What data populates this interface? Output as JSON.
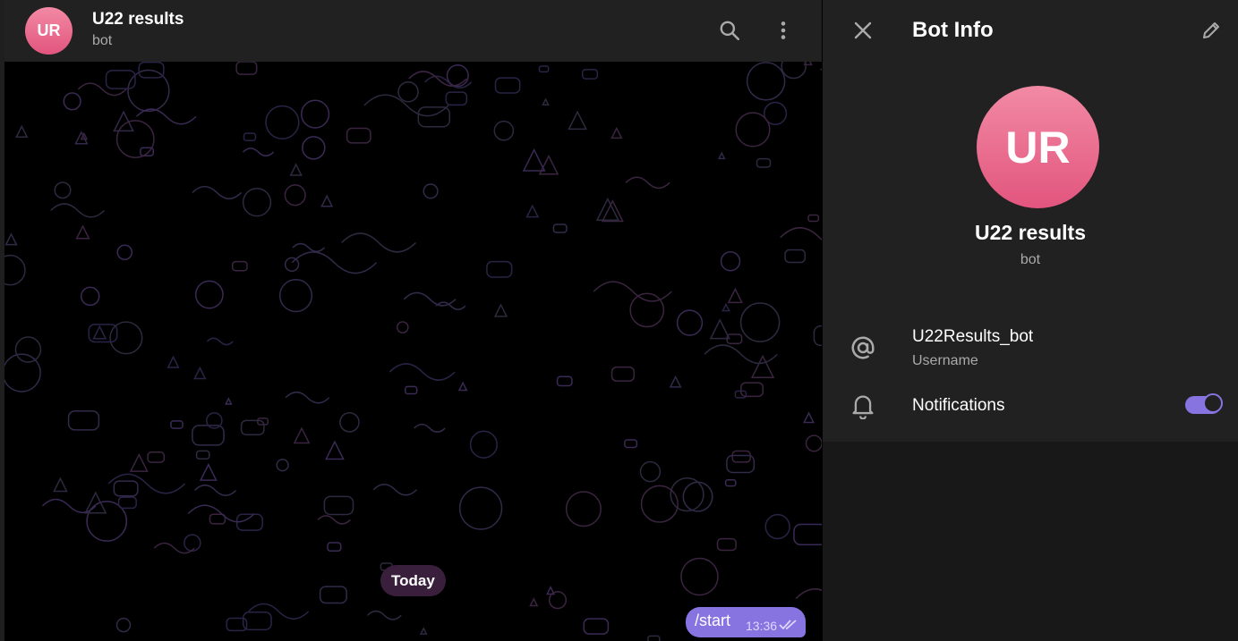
{
  "chat": {
    "avatar_initials": "UR",
    "title": "U22 results",
    "subtitle": "bot",
    "date_divider": "Today",
    "message": {
      "text": "/start",
      "time": "13:36"
    }
  },
  "panel": {
    "title": "Bot Info",
    "avatar_initials": "UR",
    "name": "U22 results",
    "subtitle": "bot",
    "username": {
      "value": "U22Results_bot",
      "label": "Username"
    },
    "notifications": {
      "label": "Notifications",
      "enabled": true
    }
  },
  "colors": {
    "accent": "#8774e1",
    "avatar_gradient": [
      "#f28aa4",
      "#e2557e"
    ],
    "header_bg": "#212121",
    "panel_bg": "#181818",
    "date_pill_bg": "#3a1f3d"
  },
  "icons": [
    "search-icon",
    "more-vertical-icon",
    "close-icon",
    "edit-icon",
    "at-icon",
    "bell-icon",
    "double-check-icon"
  ]
}
